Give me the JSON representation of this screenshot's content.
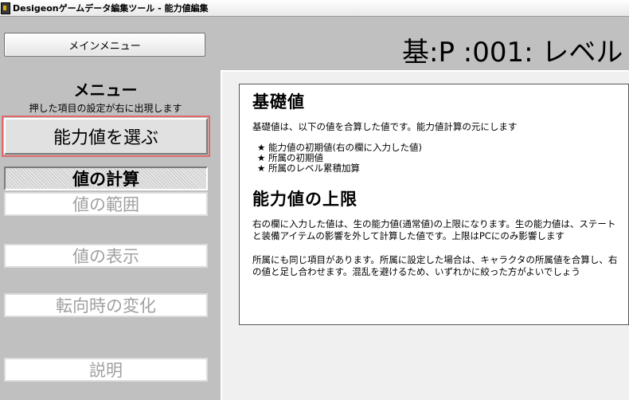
{
  "window": {
    "title": "Desigeonゲームデータ編集ツール - 能力値編集"
  },
  "sidebar": {
    "main_menu_label": "メインメニュー",
    "heading": "メニュー",
    "subtext": "押した項目の設定が右に出現します",
    "select_label": "能力値を選ぶ",
    "items": [
      {
        "label": "値の計算",
        "state": "active"
      },
      {
        "label": "値の範囲",
        "state": "disabled"
      },
      {
        "label": "値の表示",
        "state": "disabled"
      },
      {
        "label": "転向時の変化",
        "state": "disabled"
      },
      {
        "label": "説明",
        "state": "disabled"
      }
    ]
  },
  "header": {
    "title": "基:P :001: レベル"
  },
  "content": {
    "section1": {
      "heading": "基礎値",
      "paragraph": "基礎値は、以下の値を合算した値です。能力値計算の元にします",
      "bullets": [
        "★ 能力値の初期値(右の欄に入力した値)",
        "★ 所属の初期値",
        "★ 所属のレベル累積加算"
      ]
    },
    "section2": {
      "heading": "能力値の上限",
      "paragraph1": "右の欄に入力した値は、生の能力値(通常値)の上限になります。生の能力値は、ステートと装備アイテムの影響を外して計算した値です。上限はPCにのみ影響します",
      "paragraph2": "所属にも同じ項目があります。所属に設定した場合は、キャラクタの所属値を合算し、右の値と足し合わせます。混乱を避けるため、いずれかに絞った方がよいでしょう"
    }
  },
  "colors": {
    "highlight_outline": "#e06a6a",
    "window_bg": "#c0c0c0",
    "panel_bg": "#f0f0f0"
  }
}
